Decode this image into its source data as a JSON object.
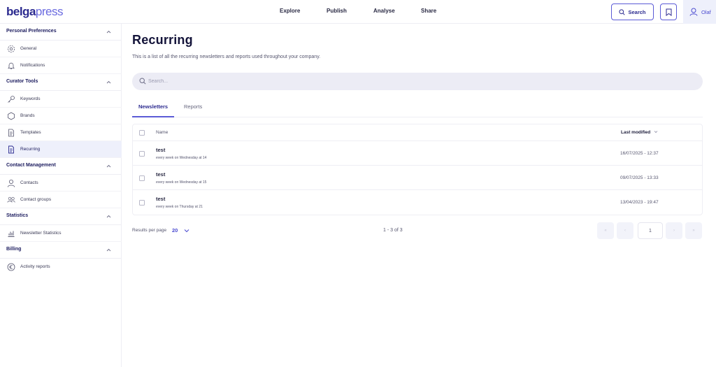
{
  "header": {
    "logo_part1": "belga",
    "logo_part2": "press",
    "nav": [
      "Explore",
      "Publish",
      "Analyse",
      "Share"
    ],
    "search_label": "Search",
    "user_name": "Olaf"
  },
  "sidebar": {
    "sections": [
      {
        "title": "Personal Preferences",
        "items": [
          "General",
          "Notifications"
        ]
      },
      {
        "title": "Curator Tools",
        "items": [
          "Keywords",
          "Brands",
          "Templates",
          "Recurring"
        ]
      },
      {
        "title": "Contact Management",
        "items": [
          "Contacts",
          "Contact groups"
        ]
      },
      {
        "title": "Statistics",
        "items": [
          "Newsletter Statistics"
        ]
      },
      {
        "title": "Billing",
        "items": [
          "Activity reports"
        ]
      }
    ],
    "active_item": "Recurring"
  },
  "main": {
    "title": "Recurring",
    "subtitle": "This is a list of all the recurring newsletters and reports used throughout your company.",
    "search_placeholder": "Search...",
    "tabs": [
      "Newsletters",
      "Reports"
    ],
    "active_tab": "Newsletters",
    "table": {
      "col_name": "Name",
      "col_modified": "Last modified",
      "rows": [
        {
          "title": "test",
          "schedule": "every week on Wednesday at 14",
          "modified": "16/07/2025 - 12:37"
        },
        {
          "title": "test",
          "schedule": "every week on Wednesday at 15",
          "modified": "09/07/2025 - 13:33"
        },
        {
          "title": "test",
          "schedule": "every week on Thursday at 21",
          "modified": "13/04/2023 - 19:47"
        }
      ]
    },
    "pagination": {
      "results_per_page_label": "Results per page",
      "results_per_page": "20",
      "range": "1 - 3 of 3",
      "current_page": "1"
    }
  },
  "colors": {
    "accent": "#5b5bd6",
    "brand_dark": "#2b2a8f",
    "active_bg": "#eef0fb"
  }
}
